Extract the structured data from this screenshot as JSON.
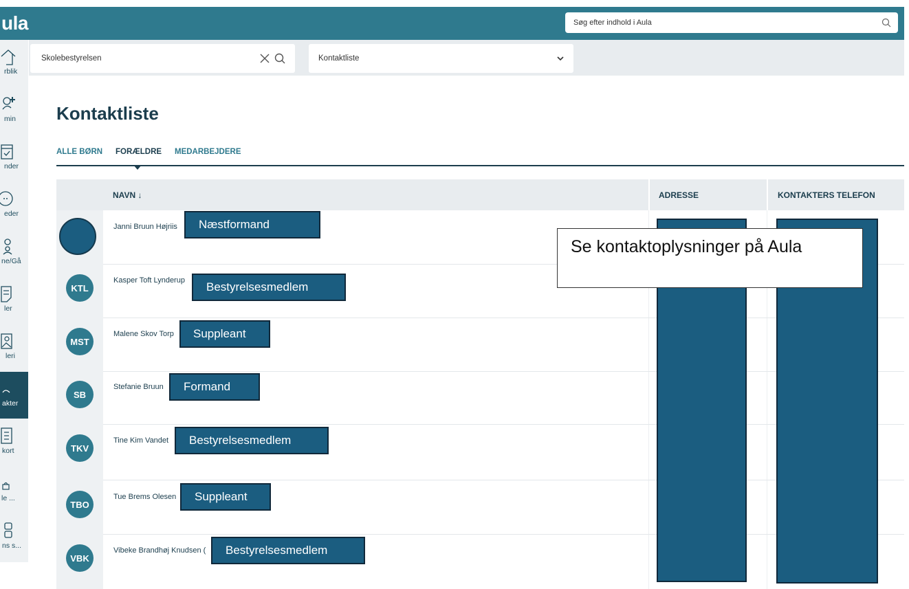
{
  "header": {
    "logo_text": "ula",
    "search_placeholder": "Søg efter indhold i Aula"
  },
  "filters": {
    "group_value": "Skolebestyrelsen",
    "list_type": "Kontaktliste"
  },
  "sidebar": {
    "items": [
      {
        "label": "rblik",
        "icon": "home-icon"
      },
      {
        "label": "min",
        "icon": "user-plus-icon"
      },
      {
        "label": "nder",
        "icon": "calendar-icon"
      },
      {
        "label": "eder",
        "icon": "messages-icon"
      },
      {
        "label": "ne/Gå",
        "icon": "presence-icon"
      },
      {
        "label": "ler",
        "icon": "document-icon"
      },
      {
        "label": "leri",
        "icon": "gallery-icon"
      },
      {
        "label": "akter",
        "icon": "contacts-icon",
        "active": true
      },
      {
        "label": "kort",
        "icon": "clipboard-icon"
      },
      {
        "label": "le ...",
        "icon": "app-icon"
      },
      {
        "label": "ns s...",
        "icon": "grid-icon"
      }
    ]
  },
  "page": {
    "title": "Kontaktliste",
    "tabs": [
      "ALLE BØRN",
      "FORÆLDRE",
      "MEDARBEJDERE"
    ],
    "active_tab": "FORÆLDRE"
  },
  "table": {
    "columns": [
      "NAVN ↓",
      "ADRESSE",
      "KONTAKTERS TELEFON"
    ],
    "rows": [
      {
        "initials": "",
        "name": "Janni Bruun Højriis",
        "role": "Næstformand"
      },
      {
        "initials": "KTL",
        "name": "Kasper Toft Lynderup",
        "role": "Bestyrelsesmedlem"
      },
      {
        "initials": "MST",
        "name": "Malene Skov Torp",
        "role": "Suppleant"
      },
      {
        "initials": "SB",
        "name": "Stefanie Bruun",
        "role": "Formand"
      },
      {
        "initials": "TKV",
        "name": "Tine Kim Vandet",
        "role": "Bestyrelsesmedlem"
      },
      {
        "initials": "TBO",
        "name": "Tue Brems Olesen",
        "role": "Suppleant"
      },
      {
        "initials": "VBK",
        "name": "Vibeke Brandhøj Knudsen (",
        "role": "Bestyrelsesmedlem"
      }
    ]
  },
  "callout": {
    "text": "Se kontaktoplysninger på Aula"
  },
  "colors": {
    "topbar": "#2f7a8e",
    "overlay": "#1b5d80",
    "title": "#1b3d4d"
  }
}
